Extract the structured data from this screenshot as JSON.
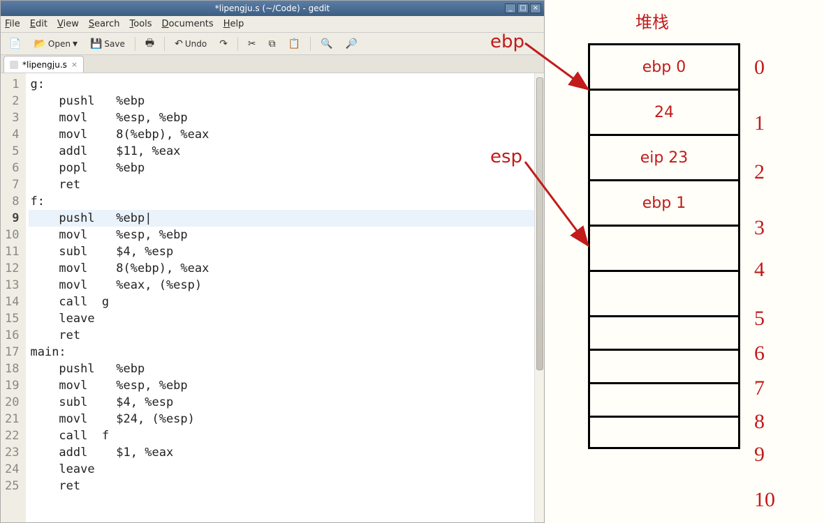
{
  "window": {
    "title": "*lipengju.s (~/Code) - gedit"
  },
  "menubar": {
    "items": [
      "File",
      "Edit",
      "View",
      "Search",
      "Tools",
      "Documents",
      "Help"
    ]
  },
  "toolbar": {
    "open_label": "Open",
    "save_label": "Save",
    "undo_label": "Undo"
  },
  "tab": {
    "name": "*lipengju.s"
  },
  "code": {
    "active_line": 9,
    "lines": [
      {
        "n": 1,
        "text": "g:"
      },
      {
        "n": 2,
        "text": "    pushl   %ebp"
      },
      {
        "n": 3,
        "text": "    movl    %esp, %ebp"
      },
      {
        "n": 4,
        "text": "    movl    8(%ebp), %eax"
      },
      {
        "n": 5,
        "text": "    addl    $11, %eax"
      },
      {
        "n": 6,
        "text": "    popl    %ebp"
      },
      {
        "n": 7,
        "text": "    ret"
      },
      {
        "n": 8,
        "text": "f:"
      },
      {
        "n": 9,
        "text": "    pushl   %ebp|"
      },
      {
        "n": 10,
        "text": "    movl    %esp, %ebp"
      },
      {
        "n": 11,
        "text": "    subl    $4, %esp"
      },
      {
        "n": 12,
        "text": "    movl    8(%ebp), %eax"
      },
      {
        "n": 13,
        "text": "    movl    %eax, (%esp)"
      },
      {
        "n": 14,
        "text": "    call  g"
      },
      {
        "n": 15,
        "text": "    leave"
      },
      {
        "n": 16,
        "text": "    ret"
      },
      {
        "n": 17,
        "text": "main:"
      },
      {
        "n": 18,
        "text": "    pushl   %ebp"
      },
      {
        "n": 19,
        "text": "    movl    %esp, %ebp"
      },
      {
        "n": 20,
        "text": "    subl    $4, %esp"
      },
      {
        "n": 21,
        "text": "    movl    $24, (%esp)"
      },
      {
        "n": 22,
        "text": "    call  f"
      },
      {
        "n": 23,
        "text": "    addl    $1, %eax"
      },
      {
        "n": 24,
        "text": "    leave"
      },
      {
        "n": 25,
        "text": "    ret"
      }
    ]
  },
  "diagram": {
    "title": "堆栈",
    "ptr_ebp": "ebp",
    "ptr_esp": "esp",
    "cells": [
      "ebp 0",
      "24",
      "eip 23",
      "ebp 1",
      "",
      "",
      "",
      "",
      "",
      ""
    ],
    "indices": [
      "0",
      "1",
      "2",
      "3",
      "4",
      "5",
      "6",
      "7",
      "8",
      "9",
      "10"
    ]
  }
}
